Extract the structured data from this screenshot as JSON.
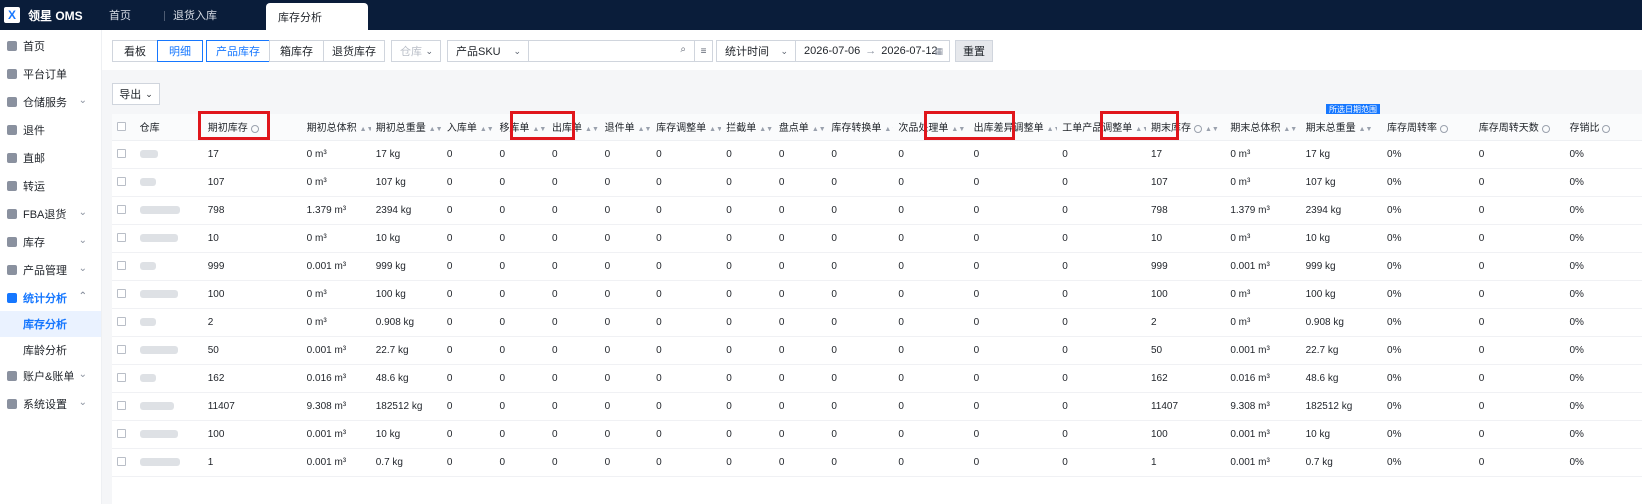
{
  "app": {
    "logo_text": "领星 OMS",
    "logo_mark": "X"
  },
  "tabs": [
    {
      "label": "首页"
    },
    {
      "label": "退货入库"
    },
    {
      "label": "库存分析"
    }
  ],
  "sidebar": {
    "items": [
      {
        "label": "首页"
      },
      {
        "label": "平台订单"
      },
      {
        "label": "仓储服务"
      },
      {
        "label": "退件"
      },
      {
        "label": "直邮"
      },
      {
        "label": "转运"
      },
      {
        "label": "FBA退货"
      },
      {
        "label": "库存"
      },
      {
        "label": "产品管理"
      },
      {
        "label": "统计分析"
      },
      {
        "label": "账户&账单"
      },
      {
        "label": "系统设置"
      }
    ],
    "sub_items": [
      {
        "label": "库存分析"
      },
      {
        "label": "库龄分析"
      }
    ]
  },
  "filters": {
    "view_buttons": [
      "看板",
      "明细"
    ],
    "type_buttons": [
      "产品库存",
      "箱库存",
      "退货库存"
    ],
    "warehouse_placeholder": "仓库",
    "sku_select": "产品SKU",
    "time_select": "统计时间",
    "date_start": "2026-07-06",
    "date_end": "2026-07-12",
    "reset_label": "重置",
    "export_label": "导出"
  },
  "range_tag": "所选日期范围",
  "table": {
    "headers": [
      "仓库",
      "期初库存",
      "期初总体积",
      "期初总重量",
      "入库单",
      "移库单",
      "出库单",
      "退件单",
      "库存调整单",
      "拦截单",
      "盘点单",
      "库存转换单",
      "次品处理单",
      "出库差异调整单",
      "工单产品调整单",
      "期末库存",
      "期末总体积",
      "期末总重量",
      "库存周转率",
      "库存周转天数",
      "存销比"
    ],
    "rows": [
      [
        "17",
        "0 m³",
        "17 kg",
        "0",
        "0",
        "0",
        "0",
        "0",
        "0",
        "0",
        "0",
        "0",
        "0",
        "0",
        "17",
        "0 m³",
        "17 kg",
        "0%",
        "0",
        "0%"
      ],
      [
        "107",
        "0 m³",
        "107 kg",
        "0",
        "0",
        "0",
        "0",
        "0",
        "0",
        "0",
        "0",
        "0",
        "0",
        "0",
        "107",
        "0 m³",
        "107 kg",
        "0%",
        "0",
        "0%"
      ],
      [
        "798",
        "1.379 m³",
        "2394 kg",
        "0",
        "0",
        "0",
        "0",
        "0",
        "0",
        "0",
        "0",
        "0",
        "0",
        "0",
        "798",
        "1.379 m³",
        "2394 kg",
        "0%",
        "0",
        "0%"
      ],
      [
        "10",
        "0 m³",
        "10 kg",
        "0",
        "0",
        "0",
        "0",
        "0",
        "0",
        "0",
        "0",
        "0",
        "0",
        "0",
        "10",
        "0 m³",
        "10 kg",
        "0%",
        "0",
        "0%"
      ],
      [
        "999",
        "0.001 m³",
        "999 kg",
        "0",
        "0",
        "0",
        "0",
        "0",
        "0",
        "0",
        "0",
        "0",
        "0",
        "0",
        "999",
        "0.001 m³",
        "999 kg",
        "0%",
        "0",
        "0%"
      ],
      [
        "100",
        "0 m³",
        "100 kg",
        "0",
        "0",
        "0",
        "0",
        "0",
        "0",
        "0",
        "0",
        "0",
        "0",
        "0",
        "100",
        "0 m³",
        "100 kg",
        "0%",
        "0",
        "0%"
      ],
      [
        "2",
        "0 m³",
        "0.908 kg",
        "0",
        "0",
        "0",
        "0",
        "0",
        "0",
        "0",
        "0",
        "0",
        "0",
        "0",
        "2",
        "0 m³",
        "0.908 kg",
        "0%",
        "0",
        "0%"
      ],
      [
        "50",
        "0.001 m³",
        "22.7 kg",
        "0",
        "0",
        "0",
        "0",
        "0",
        "0",
        "0",
        "0",
        "0",
        "0",
        "0",
        "50",
        "0.001 m³",
        "22.7 kg",
        "0%",
        "0",
        "0%"
      ],
      [
        "162",
        "0.016 m³",
        "48.6 kg",
        "0",
        "0",
        "0",
        "0",
        "0",
        "0",
        "0",
        "0",
        "0",
        "0",
        "0",
        "162",
        "0.016 m³",
        "48.6 kg",
        "0%",
        "0",
        "0%"
      ],
      [
        "11407",
        "9.308 m³",
        "182512 kg",
        "0",
        "0",
        "0",
        "0",
        "0",
        "0",
        "0",
        "0",
        "0",
        "0",
        "0",
        "11407",
        "9.308 m³",
        "182512 kg",
        "0%",
        "0",
        "0%"
      ],
      [
        "100",
        "0.001 m³",
        "10 kg",
        "0",
        "0",
        "0",
        "0",
        "0",
        "0",
        "0",
        "0",
        "0",
        "0",
        "0",
        "100",
        "0.001 m³",
        "10 kg",
        "0%",
        "0",
        "0%"
      ],
      [
        "1",
        "0.001 m³",
        "0.7 kg",
        "0",
        "0",
        "0",
        "0",
        "0",
        "0",
        "0",
        "0",
        "0",
        "0",
        "0",
        "1",
        "0.001 m³",
        "0.7 kg",
        "0%",
        "0",
        "0%"
      ]
    ]
  },
  "colors": {
    "topbar": "#0a1d3a",
    "accent": "#1677ff",
    "highlight": "#e0161c"
  }
}
